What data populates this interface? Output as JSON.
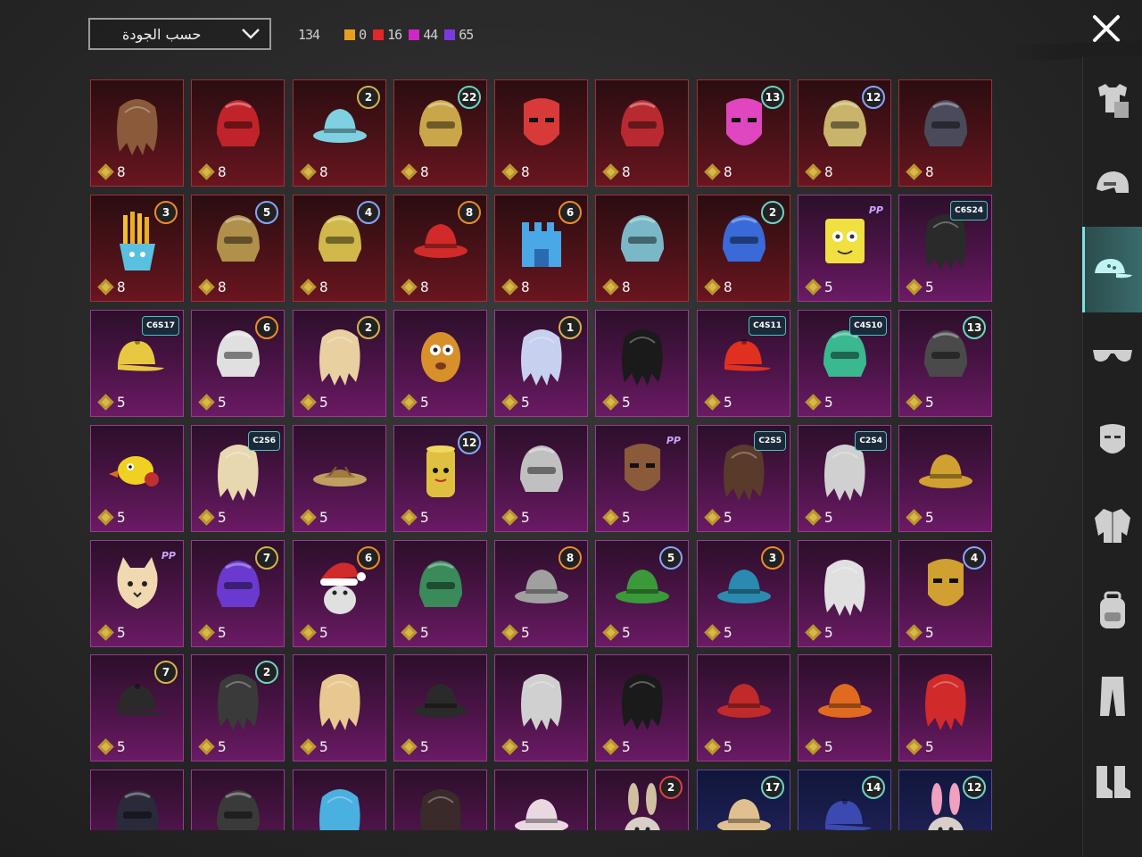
{
  "header": {
    "sort_label": "حسب الجودة",
    "total": "134",
    "counts": [
      {
        "value": "0",
        "color": "#e6a020"
      },
      {
        "value": "16",
        "color": "#e02828"
      },
      {
        "value": "44",
        "color": "#d026c8"
      },
      {
        "value": "65",
        "color": "#7a3ae0"
      }
    ]
  },
  "sidebar": {
    "items": [
      {
        "icon": "outfit-icon"
      },
      {
        "icon": "helmet-icon"
      },
      {
        "icon": "cap-icon",
        "active": true
      },
      {
        "icon": "glasses-icon"
      },
      {
        "icon": "mask-icon"
      },
      {
        "icon": "jacket-icon"
      },
      {
        "icon": "backpack-icon"
      },
      {
        "icon": "pants-icon"
      },
      {
        "icon": "boots-icon"
      }
    ]
  },
  "grid": {
    "rows": [
      [
        {
          "q": "red",
          "qty": "8",
          "art": "hair",
          "color": "#8a5a3a"
        },
        {
          "q": "red",
          "qty": "8",
          "art": "helmet",
          "color": "#c0242a"
        },
        {
          "q": "red",
          "qty": "8",
          "art": "hat",
          "color": "#7fd0e0",
          "badge": "2"
        },
        {
          "q": "red",
          "qty": "8",
          "art": "helmet",
          "color": "#c9a64a",
          "badge": "22",
          "badge_style": "teal"
        },
        {
          "q": "red",
          "qty": "8",
          "art": "mask",
          "color": "#d83a3a"
        },
        {
          "q": "red",
          "qty": "8",
          "art": "helmet",
          "color": "#b82a30"
        },
        {
          "q": "red",
          "qty": "8",
          "art": "mask",
          "color": "#e046c0",
          "badge": "13",
          "badge_style": "teal"
        },
        {
          "q": "red",
          "qty": "8",
          "art": "helmet",
          "color": "#c8b46a",
          "badge": "12",
          "badge_style": "blue"
        },
        {
          "q": "red",
          "qty": "8",
          "art": "helmet",
          "color": "#4a4a5a"
        }
      ],
      [
        {
          "q": "red",
          "qty": "8",
          "art": "fries",
          "color": "#f0b020",
          "badge": "3",
          "badge_style": "orange"
        },
        {
          "q": "red",
          "qty": "8",
          "art": "helmet",
          "color": "#b0904a",
          "badge": "5",
          "badge_style": "blue"
        },
        {
          "q": "red",
          "qty": "8",
          "art": "helmet",
          "color": "#d0b84a",
          "badge": "4",
          "badge_style": "blue"
        },
        {
          "q": "red",
          "qty": "8",
          "art": "hat",
          "color": "#d02a2a",
          "badge": "8",
          "badge_style": "orange"
        },
        {
          "q": "red",
          "qty": "8",
          "art": "castle",
          "color": "#4aa8e8",
          "badge": "6",
          "badge_style": "orange"
        },
        {
          "q": "red",
          "qty": "8",
          "art": "helmet",
          "color": "#7ab8c8"
        },
        {
          "q": "red",
          "qty": "8",
          "art": "helmet",
          "color": "#3a6ad8",
          "badge": "2",
          "badge_style": "teal"
        },
        {
          "q": "purple",
          "qty": "5",
          "art": "box",
          "color": "#f0e040",
          "season": "PP",
          "season_style": "pp"
        },
        {
          "q": "purple",
          "qty": "5",
          "art": "hair",
          "color": "#2a2a2a",
          "season": "C6S24"
        }
      ],
      [
        {
          "q": "purple",
          "qty": "5",
          "art": "cap",
          "color": "#e8c840",
          "season": "C6S17"
        },
        {
          "q": "purple",
          "qty": "5",
          "art": "helmet",
          "color": "#e0e0e0",
          "badge": "6",
          "badge_style": "orange"
        },
        {
          "q": "purple",
          "qty": "5",
          "art": "hair",
          "color": "#e8d0a0",
          "badge": "2"
        },
        {
          "q": "purple",
          "qty": "5",
          "art": "potato",
          "color": "#d8902a"
        },
        {
          "q": "purple",
          "qty": "5",
          "art": "hair",
          "color": "#c8d0f0",
          "badge": "1"
        },
        {
          "q": "purple",
          "qty": "5",
          "art": "hair",
          "color": "#1a1a1a"
        },
        {
          "q": "purple",
          "qty": "5",
          "art": "cap",
          "color": "#e03020",
          "season": "C4S11"
        },
        {
          "q": "purple",
          "qty": "5",
          "art": "helmet",
          "color": "#3ab890",
          "season": "C4S10"
        },
        {
          "q": "purple",
          "qty": "5",
          "art": "helmet",
          "color": "#4a4a4a",
          "badge": "13",
          "badge_style": "teal"
        }
      ],
      [
        {
          "q": "purple",
          "qty": "5",
          "art": "duck",
          "color": "#f0d020"
        },
        {
          "q": "purple",
          "qty": "5",
          "art": "hair",
          "color": "#e8d8b0",
          "season": "C2S6"
        },
        {
          "q": "purple",
          "qty": "5",
          "art": "nest",
          "color": "#c0a060"
        },
        {
          "q": "purple",
          "qty": "5",
          "art": "can",
          "color": "#e0c040",
          "badge": "12",
          "badge_style": "blue"
        },
        {
          "q": "purple",
          "qty": "5",
          "art": "helmet",
          "color": "#c0c0c0"
        },
        {
          "q": "purple",
          "qty": "5",
          "art": "mask",
          "color": "#8a5a3a",
          "season": "PP",
          "season_style": "pp"
        },
        {
          "q": "purple",
          "qty": "5",
          "art": "hair",
          "color": "#5a3a2a",
          "season": "C2S5"
        },
        {
          "q": "purple",
          "qty": "5",
          "art": "hair",
          "color": "#d0d0d0",
          "season": "C2S4"
        },
        {
          "q": "purple",
          "qty": "5",
          "art": "hat",
          "color": "#d0a030"
        }
      ],
      [
        {
          "q": "purple",
          "qty": "5",
          "art": "cat",
          "color": "#f0d8b0",
          "season": "PP",
          "season_style": "pp"
        },
        {
          "q": "purple",
          "qty": "5",
          "art": "helmet",
          "color": "#6a3ad0",
          "badge": "7"
        },
        {
          "q": "purple",
          "qty": "5",
          "art": "santa",
          "color": "#d02a2a",
          "badge": "6",
          "badge_style": "orange"
        },
        {
          "q": "purple",
          "qty": "5",
          "art": "helmet",
          "color": "#3a8a5a"
        },
        {
          "q": "purple",
          "qty": "5",
          "art": "hat",
          "color": "#a0a0a0",
          "badge": "8",
          "badge_style": "orange"
        },
        {
          "q": "purple",
          "qty": "5",
          "art": "hat",
          "color": "#3a9a3a",
          "badge": "5",
          "badge_style": "blue"
        },
        {
          "q": "purple",
          "qty": "5",
          "art": "hat",
          "color": "#2a8ab0",
          "badge": "3",
          "badge_style": "orange"
        },
        {
          "q": "purple",
          "qty": "5",
          "art": "hair",
          "color": "#e0e0e0"
        },
        {
          "q": "purple",
          "qty": "5",
          "art": "mask",
          "color": "#d0a030",
          "badge": "4",
          "badge_style": "blue"
        }
      ],
      [
        {
          "q": "purple",
          "qty": "5",
          "art": "cap",
          "color": "#2a2a2a",
          "badge": "7"
        },
        {
          "q": "purple",
          "qty": "5",
          "art": "hair",
          "color": "#3a3a3a",
          "badge": "2",
          "badge_style": "teal"
        },
        {
          "q": "purple",
          "qty": "5",
          "art": "hair",
          "color": "#e8c890"
        },
        {
          "q": "purple",
          "qty": "5",
          "art": "hat",
          "color": "#2a2a2a"
        },
        {
          "q": "purple",
          "qty": "5",
          "art": "hair",
          "color": "#d0d0d0"
        },
        {
          "q": "purple",
          "qty": "5",
          "art": "hair",
          "color": "#1a1a1a"
        },
        {
          "q": "purple",
          "qty": "5",
          "art": "hat",
          "color": "#c02a2a"
        },
        {
          "q": "purple",
          "qty": "5",
          "art": "hat",
          "color": "#e06a20"
        },
        {
          "q": "purple",
          "qty": "5",
          "art": "hair",
          "color": "#d02a2a"
        }
      ],
      [
        {
          "q": "purple",
          "qty": "",
          "art": "helmet",
          "color": "#2a2a3a"
        },
        {
          "q": "purple",
          "qty": "",
          "art": "helmet",
          "color": "#3a3a3a"
        },
        {
          "q": "purple",
          "qty": "",
          "art": "hair",
          "color": "#4ab0e0"
        },
        {
          "q": "purple",
          "qty": "",
          "art": "hair",
          "color": "#3a2a2a"
        },
        {
          "q": "purple",
          "qty": "",
          "art": "hat",
          "color": "#e8d8e0"
        },
        {
          "q": "purple",
          "qty": "",
          "art": "bunny",
          "color": "#d0c0a0",
          "badge": "2",
          "badge_style": "red"
        },
        {
          "q": "darkblue",
          "qty": "",
          "art": "hat",
          "color": "#e0c090",
          "badge": "17",
          "badge_style": "teal"
        },
        {
          "q": "darkblue",
          "qty": "",
          "art": "cap",
          "color": "#3a4ab0",
          "badge": "14",
          "badge_style": "teal"
        },
        {
          "q": "darkblue",
          "qty": "",
          "art": "bunny",
          "color": "#f0a0c0",
          "badge": "12",
          "badge_style": "teal"
        }
      ]
    ]
  }
}
